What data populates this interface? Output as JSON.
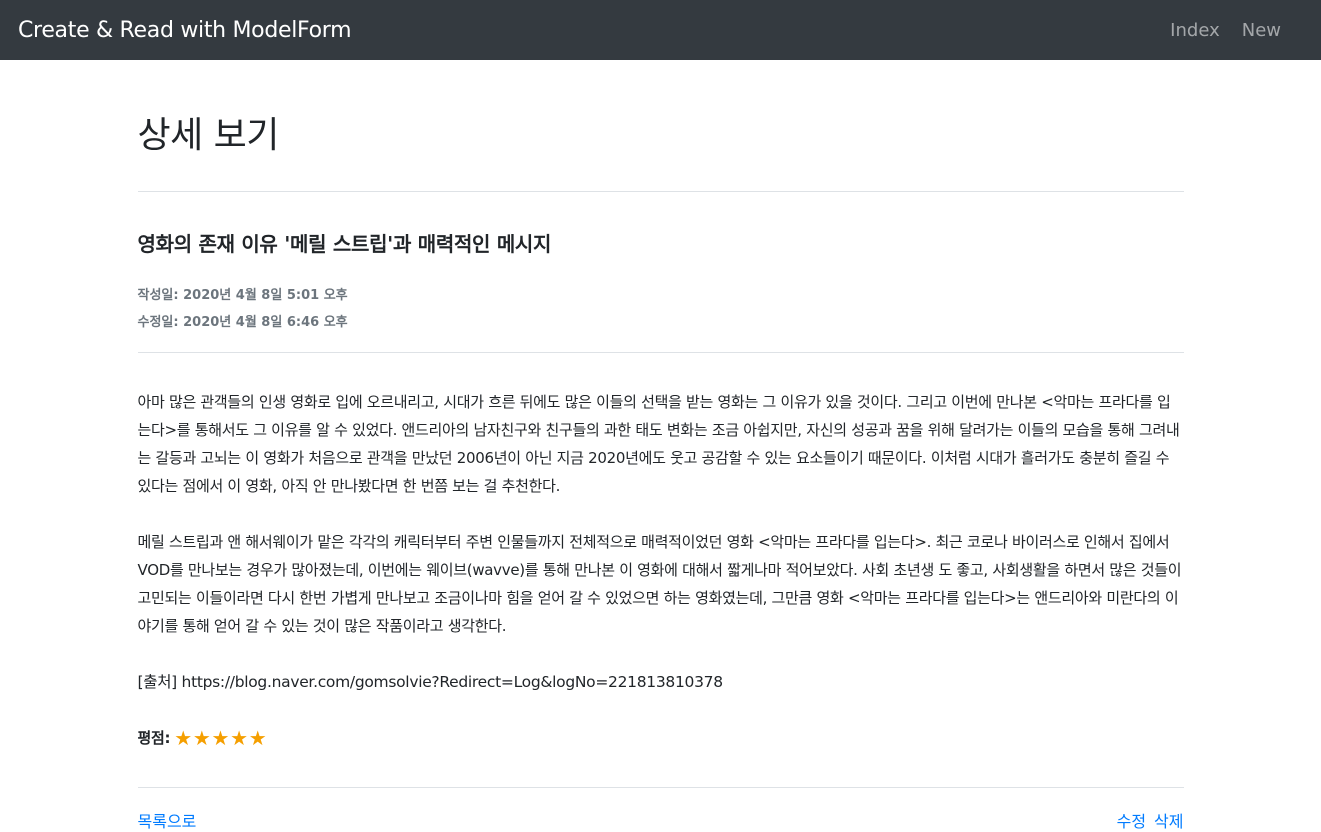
{
  "nav": {
    "brand": "Create & Read with ModelForm",
    "links": [
      "Index",
      "New"
    ]
  },
  "page": {
    "title": "상세 보기"
  },
  "post": {
    "title": "영화의 존재 이유 '메릴 스트립'과 매력적인 메시지",
    "created": "작성일: 2020년 4월 8일 5:01 오후",
    "updated": "수정일: 2020년 4월 8일 6:46 오후",
    "paragraph1": "아마 많은 관객들의 인생 영화로 입에 오르내리고, 시대가 흐른 뒤에도 많은 이들의 선택을 받는 영화는 그 이유가 있을 것이다. 그리고 이번에 만나본 <악마는 프라다를 입는다>를 통해서도 그 이유를 알 수 있었다. 앤드리아의 남자친구와 친구들의 과한 태도 변화는 조금 아쉽지만, 자신의 성공과 꿈을 위해 달려가는 이들의 모습을 통해 그려내는 갈등과 고뇌는 이 영화가 처음으로 관객을 만났던 2006년이 아닌 지금 2020년에도 웃고 공감할 수 있는 요소들이기 때문이다. 이처럼 시대가 흘러가도 충분히 즐길 수 있다는 점에서 이 영화, 아직 안 만나봤다면 한 번쯤 보는 걸 추천한다.",
    "paragraph2": "메릴 스트립과 앤 해서웨이가 맡은 각각의 캐릭터부터 주변 인물들까지 전체적으로 매력적이었던 영화 <악마는 프라다를 입는다>. 최근 코로나 바이러스로 인해서 집에서 VOD를 만나보는 경우가 많아졌는데, 이번에는 웨이브(wavve)를 통해 만나본 이 영화에 대해서 짧게나마 적어보았다. 사회 초년생 도 좋고, 사회생활을 하면서 많은 것들이 고민되는 이들이라면 다시 한번 가볍게 만나보고 조금이나마 힘을 얻어 갈 수 있었으면 하는 영화였는데, 그만큼 영화 <악마는 프라다를 입는다>는 앤드리아와 미란다의 이야기를 통해 얻어 갈 수 있는 것이 많은 작품이라고 생각한다.",
    "source": "[출처] https://blog.naver.com/gomsolvie?Redirect=Log&logNo=221813810378",
    "rating_label": "평점:",
    "rating_value": 5,
    "star_glyph": "★",
    "star_color": "#f59f00"
  },
  "footer": {
    "back": "목록으로",
    "edit": "수정",
    "delete": "삭제"
  },
  "colors": {
    "navbar": "#343a40",
    "link": "#007bff",
    "muted": "#6c757d"
  }
}
